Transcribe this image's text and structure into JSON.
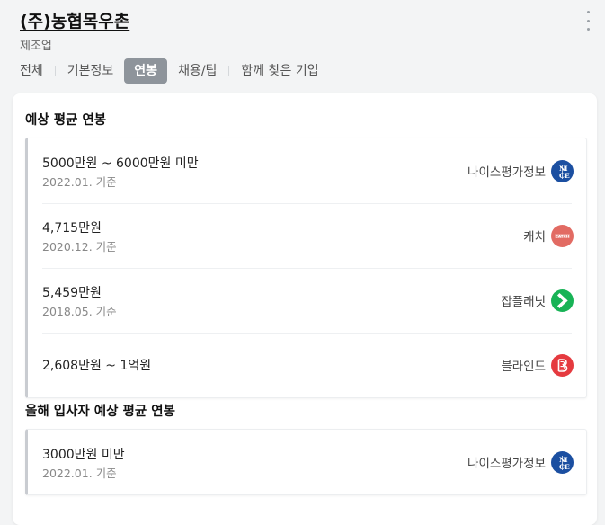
{
  "company": {
    "name": "(주)농협목우촌",
    "industry": "제조업"
  },
  "tabs": [
    {
      "label": "전체"
    },
    {
      "label": "기본정보"
    },
    {
      "label": "연봉"
    },
    {
      "label": "채용/팁"
    },
    {
      "label": "함께 찾은 기업"
    }
  ],
  "active_tab": "연봉",
  "sections": [
    {
      "title": "예상 평균 연봉",
      "rows": [
        {
          "amount": "5000만원 ~ 6000만원 미만",
          "date": "2022.01. 기준",
          "source": "나이스평가정보",
          "logo_icon": "nice-logo-icon",
          "logo_color": "#1b4fa1"
        },
        {
          "amount": "4,715만원",
          "date": "2020.12. 기준",
          "source": "캐치",
          "logo_icon": "catch-logo-icon",
          "logo_color": "#e26b63",
          "logo_text": "CATCH"
        },
        {
          "amount": "5,459만원",
          "date": "2018.05. 기준",
          "source": "잡플래닛",
          "logo_icon": "jobplanet-logo-icon",
          "logo_color": "#18b356"
        },
        {
          "amount": "2,608만원 ~ 1억원",
          "date": "",
          "source": "블라인드",
          "logo_icon": "blind-logo-icon",
          "logo_color": "#e53a3f"
        }
      ]
    },
    {
      "title": "올해 입사자 예상 평균 연봉",
      "rows": [
        {
          "amount": "3000만원 미만",
          "date": "2022.01. 기준",
          "source": "나이스평가정보",
          "logo_icon": "nice-logo-icon",
          "logo_color": "#1b4fa1"
        }
      ]
    }
  ]
}
